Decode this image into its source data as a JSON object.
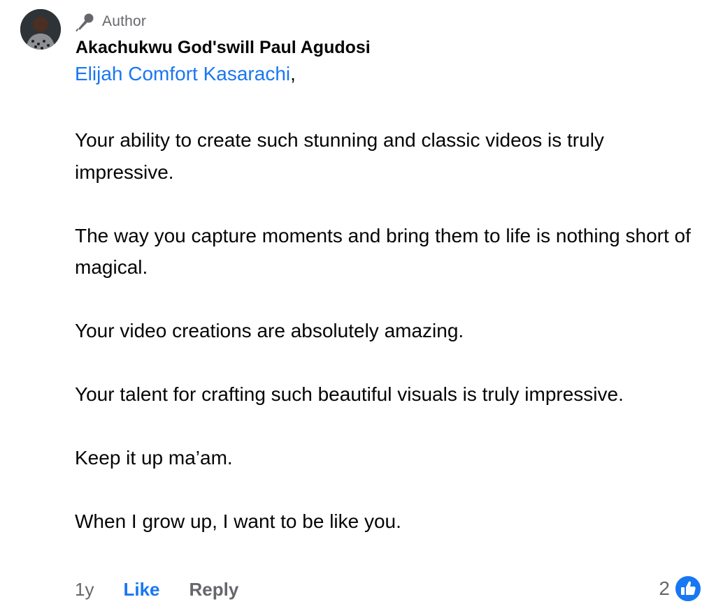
{
  "comment": {
    "badge_label": "Author",
    "author_name": "Akachukwu God'swill Paul Agudosi",
    "mention_name": "Elijah Comfort Kasarachi",
    "mention_suffix": ",",
    "paragraphs": [
      "Your ability to create such stunning and classic videos is truly impressive.",
      "The way you capture moments and bring them to life is nothing short of magical.",
      "Your video creations are absolutely amazing.",
      "Your talent for crafting such beautiful visuals is truly impressive.",
      "Keep it up ma’am.",
      "When I grow up, I want to be like you."
    ],
    "time_ago": "1y",
    "like_label": "Like",
    "reply_label": "Reply",
    "reaction_count": "2",
    "icons": {
      "badge": "microphone-icon",
      "reaction": "thumbs-up-icon"
    },
    "colors": {
      "link": "#1877f2",
      "secondary_text": "#65676b",
      "primary_text": "#050505"
    }
  }
}
